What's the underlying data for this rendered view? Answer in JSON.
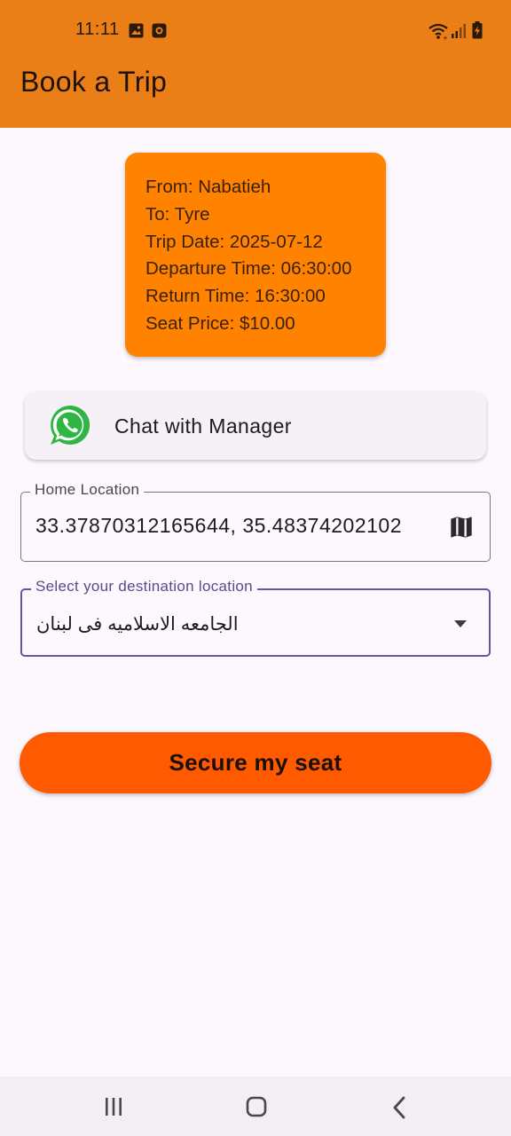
{
  "status_bar": {
    "time": "11:11",
    "icons": [
      "gallery-icon",
      "app-notification-icon",
      "wifi-icon",
      "signal-icon",
      "battery-charging-icon"
    ]
  },
  "header": {
    "title": "Book a Trip",
    "background": "#ea7f17"
  },
  "trip_card": {
    "background": "#ff8300",
    "lines": [
      "From: Nabatieh",
      "To: Tyre",
      "Trip Date: 2025-07-12",
      "Departure Time: 06:30:00",
      "Return Time: 16:30:00",
      "Seat Price: $10.00"
    ]
  },
  "chat_button": {
    "label": "Chat with Manager",
    "icon": "whatsapp-icon"
  },
  "home_location": {
    "label": "Home Location",
    "value": "33.37870312165644, 35.48374202102",
    "icon": "map-icon"
  },
  "destination": {
    "label": "Select your destination location",
    "selected": "الجامعه الاسلاميه فى لبنان",
    "icon": "dropdown-arrow-icon",
    "accent": "#6b52a3"
  },
  "secure_button": {
    "label": "Secure my seat",
    "background": "#ff5a00"
  },
  "nav_bar": {
    "items": [
      "recent-apps-icon",
      "home-icon",
      "back-icon"
    ]
  }
}
